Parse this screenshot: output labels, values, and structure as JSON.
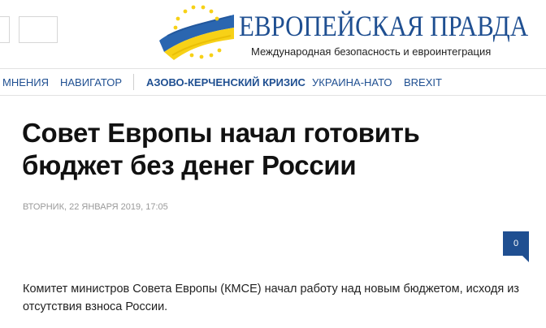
{
  "header": {
    "logo": {
      "title": "ЕВРОПЕЙСКАЯ ПРАВДА",
      "subtitle": "Международная безопасность и евроинтеграция",
      "icon": "flag-stars-logo-icon"
    }
  },
  "nav": {
    "items": [
      {
        "label": "МНЕНИЯ"
      },
      {
        "label": "НАВИГАТОР"
      },
      {
        "label": "АЗОВО-КЕРЧЕНСКИЙ КРИЗИС"
      },
      {
        "label": "УКРАИНА-НАТО"
      },
      {
        "label": "BREXIT"
      }
    ]
  },
  "article": {
    "headline": "Совет Европы начал готовить бюджет без денег России",
    "date": "ВТОРНИК, 22 ЯНВАРЯ 2019, 17:05",
    "comments_count": "0",
    "lead": "Комитет министров Совета Европы (КМСЕ) начал работу над новым бюджетом, исходя из отсутствия взноса России."
  },
  "colors": {
    "brand_blue": "#1f4f91",
    "flag_yellow": "#f7d117",
    "flag_blue": "#2a66b0"
  }
}
